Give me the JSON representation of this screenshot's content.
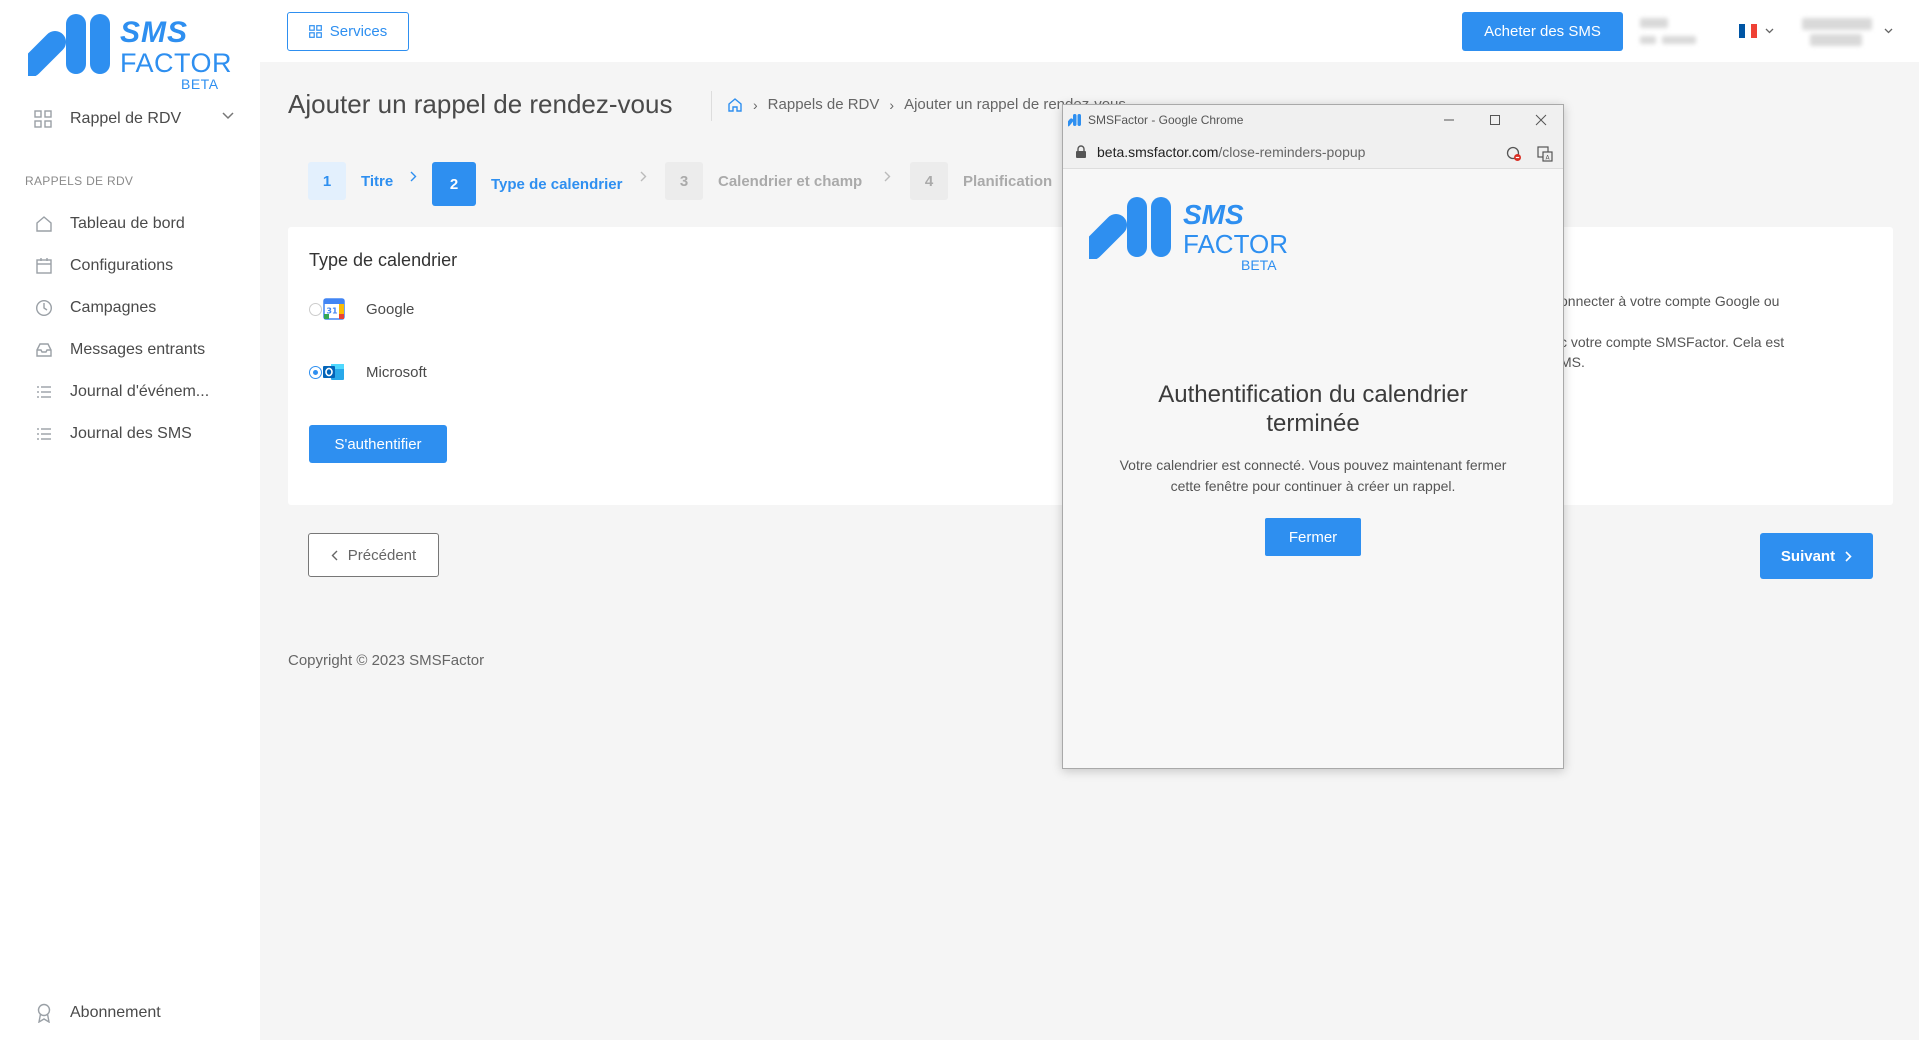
{
  "brand": {
    "sms": "SMS",
    "factor": "FACTOR",
    "beta": "BETA"
  },
  "sidebar": {
    "module_label": "Rappel de RDV",
    "section_title": "RAPPELS DE RDV",
    "items": [
      {
        "label": "Tableau de bord",
        "icon": "home-icon"
      },
      {
        "label": "Configurations",
        "icon": "calendar-icon"
      },
      {
        "label": "Campagnes",
        "icon": "clock-icon"
      },
      {
        "label": "Messages entrants",
        "icon": "inbox-icon"
      },
      {
        "label": "Journal d'événem...",
        "icon": "list-icon"
      },
      {
        "label": "Journal des SMS",
        "icon": "list-icon"
      }
    ],
    "bottom_item": {
      "label": "Abonnement",
      "icon": "award-icon"
    }
  },
  "topbar": {
    "services_label": "Services",
    "buy_label": "Acheter des SMS",
    "flag_colors": [
      "#0055a4",
      "#ffffff",
      "#ef4135"
    ]
  },
  "page": {
    "title": "Ajouter un rappel de rendez-vous",
    "breadcrumb": [
      "Rappels de RDV",
      "Ajouter un rappel de rendez-vous"
    ]
  },
  "stepper": [
    {
      "num": "1",
      "label": "Titre",
      "state": "done"
    },
    {
      "num": "2",
      "label": "Type de calendrier",
      "state": "active"
    },
    {
      "num": "3",
      "label": "Calendrier et champ",
      "state": "pending"
    },
    {
      "num": "4",
      "label": "Planification",
      "state": "pending"
    }
  ],
  "card": {
    "title": "Type de calendrier",
    "options": [
      {
        "label": "Google",
        "checked": false
      },
      {
        "label": "Microsoft",
        "checked": true
      }
    ],
    "auth_label": "S'authentifier",
    "side_text": [
      "onnecter à votre compte Google ou",
      "c votre compte SMSFactor. Cela est",
      "MS."
    ]
  },
  "nav": {
    "prev_label": "Précédent",
    "next_label": "Suivant"
  },
  "footer": {
    "copyright": "Copyright © 2023 SMSFactor"
  },
  "popup": {
    "window_title": "SMSFactor - Google Chrome",
    "url_host": "beta.smsfactor.com",
    "url_path": "/close-reminders-popup",
    "heading_line1": "Authentification du calendrier",
    "heading_line2": "terminée",
    "text_line1": "Votre calendrier est connecté. Vous pouvez maintenant fermer",
    "text_line2": "cette fenêtre pour continuer à créer un rappel.",
    "close_label": "Fermer"
  },
  "colors": {
    "accent": "#2e8ff0",
    "pending_step_bg": "#ececec",
    "active_step_bg": "#2e8ff0",
    "done_step_bg": "#e3f0fd"
  }
}
